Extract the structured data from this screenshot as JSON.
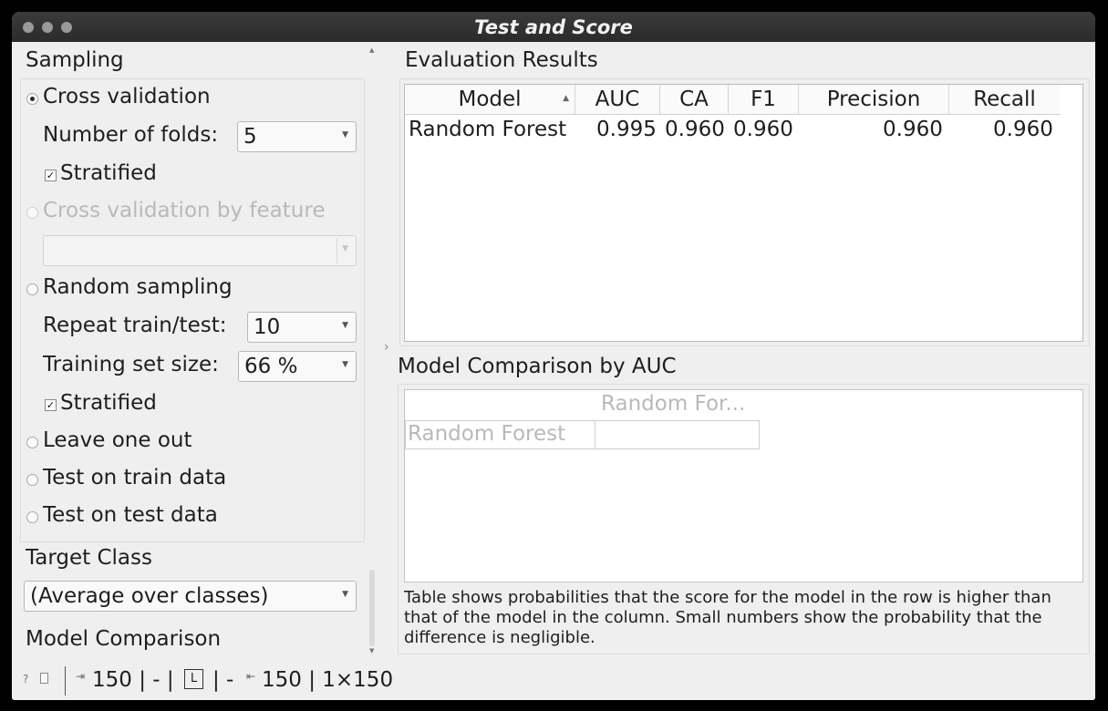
{
  "window": {
    "title": "Test and Score"
  },
  "sampling": {
    "title": "Sampling",
    "cross_validation": "Cross validation",
    "folds_label": "Number of folds:",
    "folds_value": "5",
    "stratified_1": "Stratified",
    "cv_by_feature": "Cross validation by feature",
    "random_sampling": "Random sampling",
    "repeat_label": "Repeat train/test:",
    "repeat_value": "10",
    "train_size_label": "Training set size:",
    "train_size_value": "66 %",
    "stratified_2": "Stratified",
    "leave_one_out": "Leave one out",
    "test_on_train": "Test on train data",
    "test_on_test": "Test on test data"
  },
  "target_class": {
    "title": "Target Class",
    "value": "(Average over classes)"
  },
  "model_comparison_section": {
    "title": "Model Comparison"
  },
  "evaluation": {
    "title": "Evaluation Results",
    "columns": [
      "Model",
      "AUC",
      "CA",
      "F1",
      "Precision",
      "Recall"
    ],
    "rows": [
      [
        "Random Forest",
        "0.995",
        "0.960",
        "0.960",
        "0.960",
        "0.960"
      ]
    ]
  },
  "comparison": {
    "title": "Model Comparison by AUC",
    "col_header": "Random For...",
    "row_header": "Random Forest",
    "note": "Table shows probabilities that the score for the model in the row is higher than that of the model in the column. Small numbers show the probability that the difference is negligible."
  },
  "statusbar": {
    "input_count": "150 | - |",
    "learner_badge": "L",
    "sep": "| -",
    "output_count": "150 | 1×150"
  },
  "icons": [
    "help-icon",
    "report-icon",
    "input-icon",
    "learner-icon",
    "output-icon",
    "expand-arrow-icon"
  ]
}
